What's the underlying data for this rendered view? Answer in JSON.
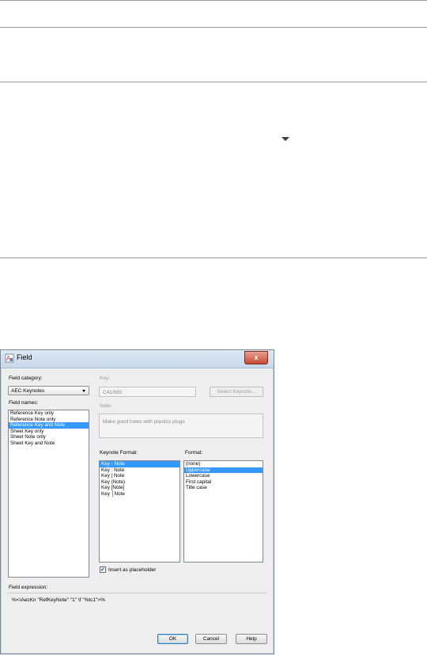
{
  "dialog": {
    "title": "Field",
    "close_glyph": "x",
    "field_category_label": "Field category:",
    "field_category_value": "AEC Keynotes",
    "field_names_label": "Field names:",
    "field_names": [
      "Reference Key only",
      "Reference Note only",
      "Reference Key and Note",
      "Sheet Key only",
      "Sheet Note only",
      "Sheet Key and Note"
    ],
    "field_names_selected_index": 2,
    "key_label": "Key:",
    "key_value": "C41/692",
    "select_keynote_button": "Select Keynote...",
    "note_label": "Note:",
    "note_value": "Make good holes with plastics plugs",
    "keynote_format_label": "Keynote Format:",
    "keynote_formats": [
      "Key - Note",
      "Key : Note",
      "Key | Note",
      "Key (Note)",
      "Key [Note]",
      "Key │Note"
    ],
    "keynote_format_selected_index": 0,
    "format_label": "Format:",
    "formats": [
      "(none)",
      "Uppercase",
      "Lowercase",
      "First capital",
      "Title case"
    ],
    "format_selected_index": 1,
    "insert_placeholder_label": "Insert as placeholder",
    "insert_placeholder_checked": "✔",
    "field_expression_label": "Field expression:",
    "field_expression_value": "%<\\AecKn \"RefKeyNote\" \"1\" \\f \"%tc1\">%",
    "ok_button": "OK",
    "cancel_button": "Cancel",
    "help_button": "Help"
  },
  "colors": {
    "selection": "#3399ff",
    "titlebar": "#c7d7ea",
    "close_button": "#c64c32"
  }
}
